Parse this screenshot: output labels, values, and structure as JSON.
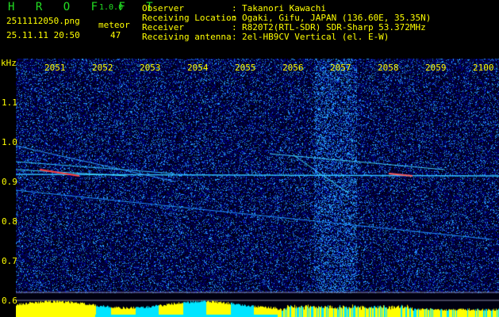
{
  "app": {
    "name": "H R O F F T",
    "version": "1.0.0"
  },
  "file": "2511112050.png",
  "datetime": "25.11.11 20:50",
  "meteor": {
    "label": "meteor",
    "count": "47"
  },
  "info": [
    {
      "label": "Observer",
      "value": "Takanori Kawachi"
    },
    {
      "label": "Receiving Location",
      "value": "Ogaki, Gifu, JAPAN (136.60E, 35.35N)"
    },
    {
      "label": "Receiver",
      "value": "R820T2(RTL-SDR) SDR-Sharp 53.372MHz"
    },
    {
      "label": "Receiving antenna",
      "value": "2el-HB9CV Vertical (el. E-W)"
    }
  ],
  "y_axis": {
    "unit": "kHz",
    "ticks": [
      "1.1",
      "1.0",
      "0.9",
      "0.8",
      "0.7",
      "0.6"
    ]
  },
  "x_axis": {
    "ticks": [
      "2051",
      "2052",
      "2053",
      "2054",
      "2055",
      "2056",
      "2057",
      "2058",
      "2059",
      "2100"
    ]
  },
  "colors": {
    "text": "#ffff00",
    "logo": "#22dd22",
    "background": "#000000",
    "noise": "#0000aa",
    "level_high": "#ffff00",
    "level_low": "#00e5ff"
  }
}
